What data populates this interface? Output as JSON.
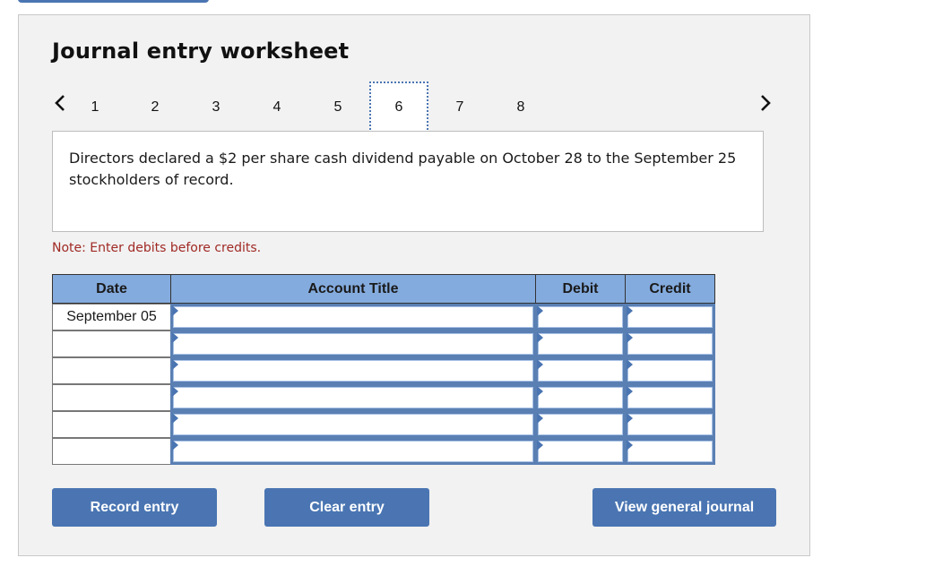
{
  "header": {
    "title": "Journal entry worksheet"
  },
  "navigation": {
    "prev_icon": "chevron-left-icon",
    "next_icon": "chevron-right-icon",
    "steps": [
      "1",
      "2",
      "3",
      "4",
      "5",
      "6",
      "7",
      "8"
    ],
    "active_step": "6"
  },
  "description": {
    "text": "Directors declared a $2 per share cash dividend payable on October 28 to the September 25 stockholders of record."
  },
  "note": "Note: Enter debits before credits.",
  "table": {
    "columns": [
      "Date",
      "Account Title",
      "Debit",
      "Credit"
    ],
    "rows": [
      {
        "date": "September 05",
        "account": "",
        "debit": "",
        "credit": ""
      },
      {
        "date": "",
        "account": "",
        "debit": "",
        "credit": ""
      },
      {
        "date": "",
        "account": "",
        "debit": "",
        "credit": ""
      },
      {
        "date": "",
        "account": "",
        "debit": "",
        "credit": ""
      },
      {
        "date": "",
        "account": "",
        "debit": "",
        "credit": ""
      },
      {
        "date": "",
        "account": "",
        "debit": "",
        "credit": ""
      }
    ]
  },
  "buttons": {
    "record": "Record entry",
    "clear": "Clear entry",
    "view_journal": "View general journal"
  },
  "colors": {
    "accent": "#4a75b2",
    "header_bg": "#84abde",
    "note": "#a02a25",
    "panel_bg": "#f2f2f2"
  }
}
